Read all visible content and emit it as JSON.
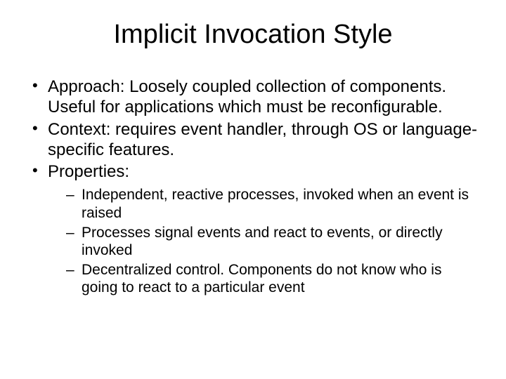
{
  "title": "Implicit Invocation Style",
  "bullets": [
    {
      "text": "Approach:  Loosely coupled collection of components. Useful for applications which must be reconfigurable."
    },
    {
      "text": "Context: requires event handler, through OS or language-specific features."
    },
    {
      "text": "Properties:",
      "sub": [
        "Independent, reactive processes, invoked when an event is raised",
        "Processes signal events and react to events, or directly invoked",
        "Decentralized control. Components do not know who is going to react to a particular event"
      ]
    }
  ]
}
